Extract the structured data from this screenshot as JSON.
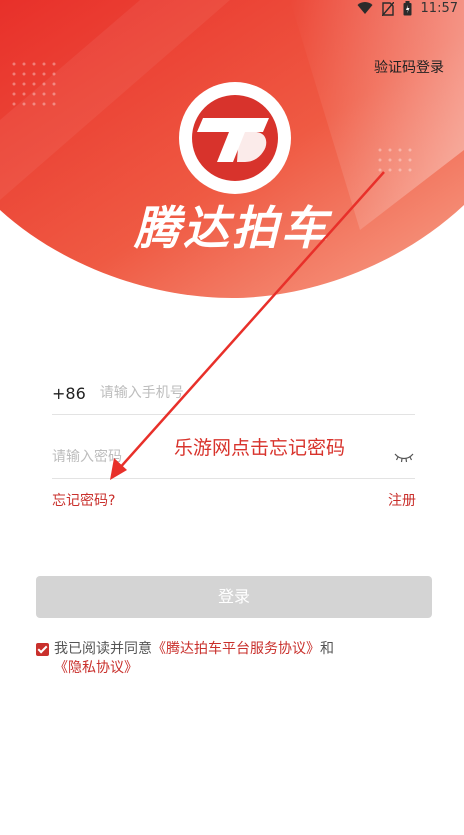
{
  "status": {
    "time": "11:57"
  },
  "header": {
    "sms_login": "验证码登录"
  },
  "brand": {
    "name": "腾达拍车"
  },
  "form": {
    "country_code": "+86",
    "phone_placeholder": "请输入手机号",
    "password_placeholder": "请输入密码",
    "forgot": "忘记密码?",
    "register": "注册",
    "login_button": "登录"
  },
  "annotation": "乐游网点击忘记密码",
  "agreement": {
    "prefix": "我已阅读并同意",
    "service_link": "《腾达拍车平台服务协议》",
    "and": "和",
    "privacy_link": "《隐私协议》",
    "checked": true
  },
  "colors": {
    "brand_red": "#d8332c",
    "link_red": "#c9302c",
    "disabled_button": "#d4d4d4"
  }
}
